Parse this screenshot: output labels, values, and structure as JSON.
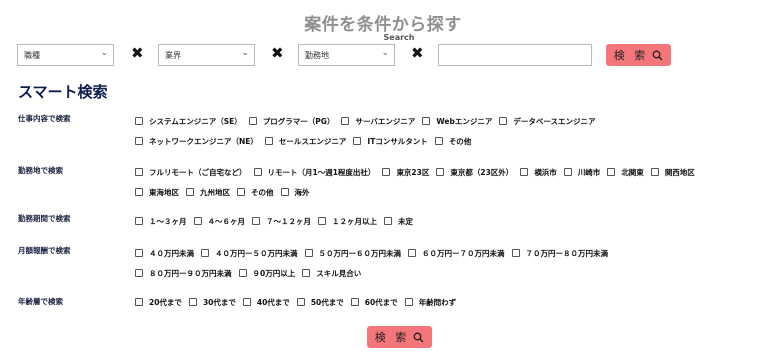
{
  "header": {
    "title": "案件を条件から探す",
    "subtitle": "Search"
  },
  "search_bar": {
    "job_select": "職種",
    "industry_select": "業界",
    "location_select": "勤務地",
    "separator": "✖",
    "free_text_value": "",
    "search_label": "検 索"
  },
  "smart_search": {
    "heading": "スマート検索",
    "categories": [
      {
        "label": "仕事内容で検索",
        "rows": [
          [
            "システムエンジニア（SE）",
            "プログラマー（PG）",
            "サーバエンジニア",
            "Webエンジニア",
            "データベースエンジニア"
          ],
          [
            "ネットワークエンジニア（NE）",
            "セールスエンジニア",
            "ITコンサルタント",
            "その他"
          ]
        ]
      },
      {
        "label": "勤務地で検索",
        "rows": [
          [
            "フルリモート（ご自宅など）",
            "リモート（月1〜週1程度出社）",
            "東京23区",
            "東京都（23区外）",
            "横浜市",
            "川崎市",
            "北関東",
            "関西地区"
          ],
          [
            "東海地区",
            "九州地区",
            "その他",
            "海外"
          ]
        ]
      },
      {
        "label": "勤務期間で検索",
        "rows": [
          [
            "１〜３ヶ月",
            "４〜６ヶ月",
            "７〜１２ヶ月",
            "１２ヶ月以上",
            "未定"
          ]
        ]
      },
      {
        "label": "月額報酬で検索",
        "rows": [
          [
            "４０万円未満",
            "４０万円ー５０万円未満",
            "５０万円ー６０万円未満",
            "６０万円ー７０万円未満",
            "７０万円ー８０万円未満"
          ],
          [
            "８０万円ー９０万円未満",
            "９0万円以上",
            "スキル見合い"
          ]
        ]
      },
      {
        "label": "年齢層で検索",
        "rows": [
          [
            "20代まで",
            "30代まで",
            "40代まで",
            "50代まで",
            "60代まで",
            "年齢問わず"
          ]
        ]
      }
    ],
    "search_label": "検 索"
  },
  "colors": {
    "button": "#f4767a",
    "heading": "#0d1c4f",
    "title": "#8f8f8f"
  },
  "icons": {
    "search_button_icon": "search-icon",
    "select_icon": "chevron-down-icon"
  }
}
